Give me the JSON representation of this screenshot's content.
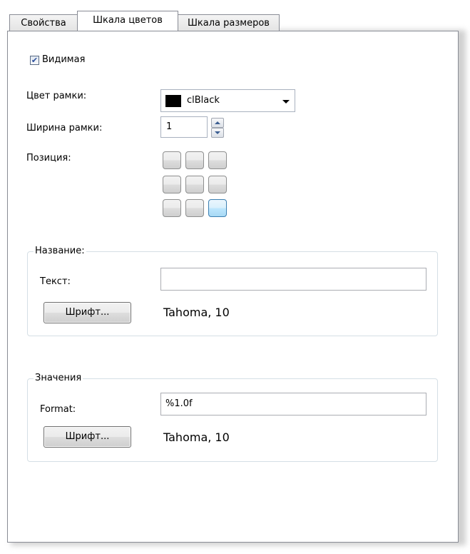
{
  "tabs": [
    {
      "label": "Свойства",
      "active": false
    },
    {
      "label": "Шкала цветов",
      "active": true
    },
    {
      "label": "Шкала размеров",
      "active": false
    }
  ],
  "visible": {
    "label": "Видимая",
    "checked": true
  },
  "border_color": {
    "label": "Цвет рамки:",
    "value": "clBlack",
    "swatch": "#000000"
  },
  "border_width": {
    "label": "Ширина рамки:",
    "value": "1"
  },
  "position": {
    "label": "Позиция:",
    "selected": "bottom-right"
  },
  "title_group": {
    "legend": "Название:",
    "text_label": "Текст:",
    "text_value": "",
    "font_button": "Шрифт...",
    "font_info": "Tahoma, 10"
  },
  "values_group": {
    "legend": "Значения",
    "format_label": "Format:",
    "format_value": "%1.0f",
    "font_button": "Шрифт...",
    "font_info": "Tahoma, 10"
  },
  "colors": {
    "accent": "#3c7fb1",
    "border": "#898c95"
  }
}
